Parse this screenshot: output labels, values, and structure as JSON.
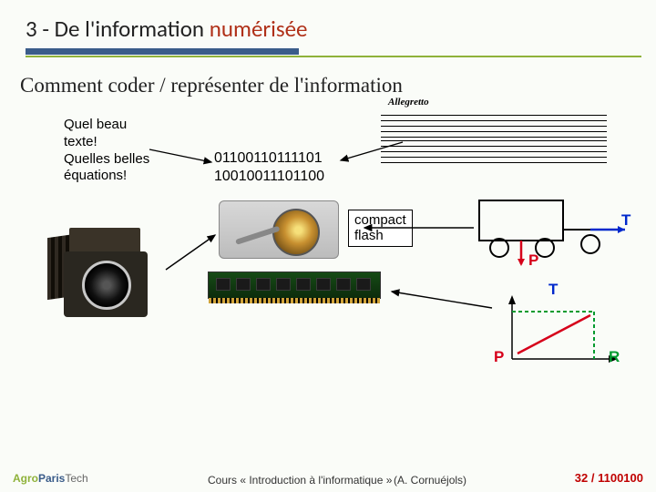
{
  "title": {
    "prefix": "3 - De l'information ",
    "accent": "numérisée"
  },
  "subtitle": "Comment coder / représenter de l'information",
  "text_example": {
    "l1": "Quel beau",
    "l2": "texte!",
    "l3": "Quelles belles",
    "l4": "équations!"
  },
  "binary": {
    "l1": "01100110111101",
    "l2": "10010011101100"
  },
  "cf_label": {
    "l1": "compact",
    "l2": "flash"
  },
  "score_marking": "Allegretto",
  "physics": {
    "T": "T",
    "P": "P",
    "R": "R"
  },
  "footer": {
    "logo_a": "Agro",
    "logo_p": "Paris",
    "logo_t": "Tech",
    "course": "Cours  « Introduction à l'informatique »",
    "author": "(A. Cornuéjols)",
    "page_current": "32",
    "sep": " / ",
    "page_total": "1100100"
  },
  "icons": {
    "hdd": "hard-disk-icon",
    "ram": "ram-stick-icon",
    "camera": "vintage-camera-icon",
    "score": "music-score-icon",
    "truck": "truck-diagram-icon",
    "graph": "pt-graph-icon"
  }
}
